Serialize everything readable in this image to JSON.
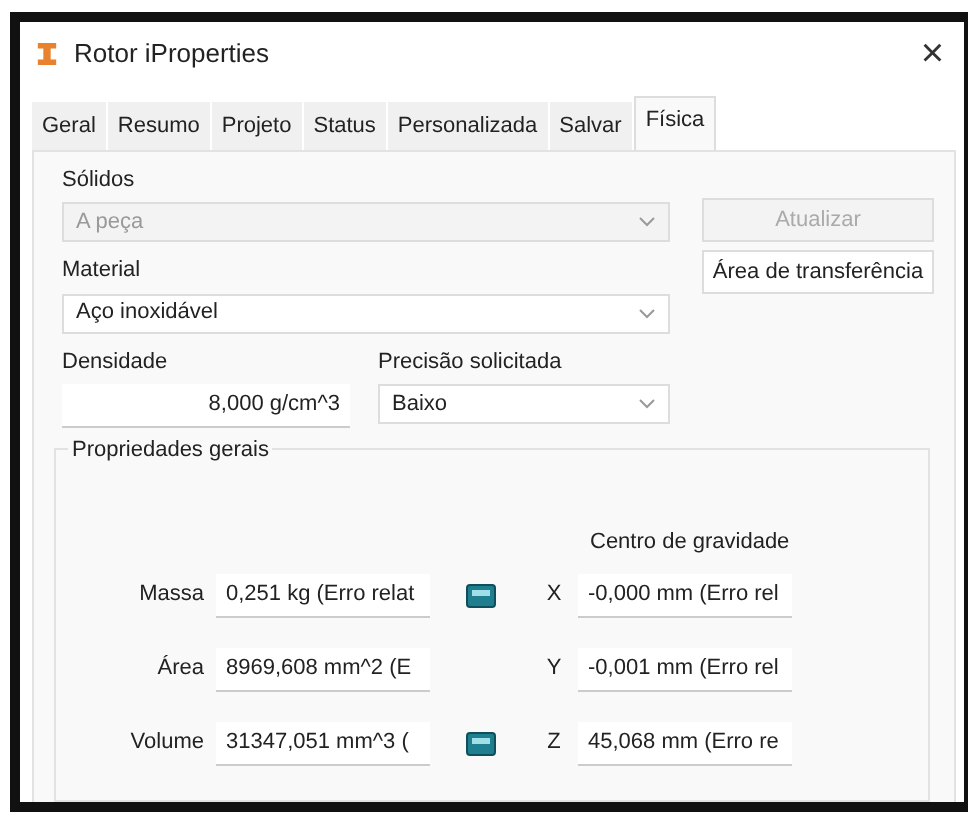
{
  "window": {
    "title": "Rotor iProperties",
    "close": "×"
  },
  "tabs": [
    {
      "label": "Geral",
      "selected": false
    },
    {
      "label": "Resumo",
      "selected": false
    },
    {
      "label": "Projeto",
      "selected": false
    },
    {
      "label": "Status",
      "selected": false
    },
    {
      "label": "Personalizada",
      "selected": false
    },
    {
      "label": "Salvar",
      "selected": false
    },
    {
      "label": "Física",
      "selected": true
    }
  ],
  "solids": {
    "label": "Sólidos",
    "value": "A peça",
    "disabled": true
  },
  "update_button": {
    "label": "Atualizar",
    "disabled": true
  },
  "material": {
    "label": "Material",
    "value": "Aço inoxidável",
    "disabled": false
  },
  "clipboard_button": {
    "label": "Área de transferência",
    "disabled": false
  },
  "density": {
    "label": "Densidade",
    "value": "8,000 g/cm^3"
  },
  "precision": {
    "label": "Precisão solicitada",
    "value": "Baixo",
    "disabled": false
  },
  "general": {
    "title": "Propriedades gerais",
    "center_title": "Centro de gravidade",
    "rows": [
      {
        "label": "Massa",
        "value": "0,251 kg (Erro relat",
        "icon": true,
        "axis": "X",
        "axis_value": "-0,000 mm (Erro rel"
      },
      {
        "label": "Área",
        "value": "8969,608 mm^2 (E",
        "icon": false,
        "axis": "Y",
        "axis_value": "-0,001 mm (Erro rel"
      },
      {
        "label": "Volume",
        "value": "31347,051 mm^3 (",
        "icon": true,
        "axis": "Z",
        "axis_value": "45,068 mm (Erro re"
      }
    ]
  }
}
